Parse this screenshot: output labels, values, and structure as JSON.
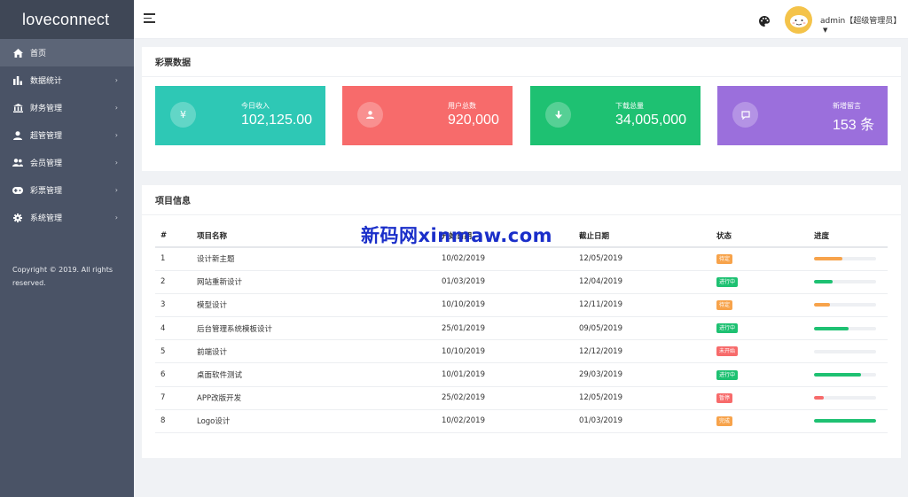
{
  "app": {
    "brand": "loveconnect"
  },
  "sidebar": {
    "items": [
      {
        "label": "首页",
        "icon": "home-icon",
        "active": true
      },
      {
        "label": "数据统计",
        "icon": "bar-chart-icon"
      },
      {
        "label": "财务管理",
        "icon": "bank-icon"
      },
      {
        "label": "超管管理",
        "icon": "person-icon"
      },
      {
        "label": "会员管理",
        "icon": "group-icon"
      },
      {
        "label": "彩票管理",
        "icon": "gamepad-icon"
      },
      {
        "label": "系统管理",
        "icon": "gear-icon"
      }
    ],
    "copyright": "Copyright © 2019. All rights reserved."
  },
  "header": {
    "user": "admin【超级管理员】"
  },
  "lottery": {
    "title": "彩票数据",
    "cards": [
      {
        "label": "今日收入",
        "value": "102,125.00",
        "color": "#2ec8b5",
        "icon": "yen-icon",
        "glyph": "¥"
      },
      {
        "label": "用户总数",
        "value": "920,000",
        "color": "#f76b6b",
        "icon": "user-icon",
        "glyph": "●"
      },
      {
        "label": "下载总量",
        "value": "34,005,000",
        "color": "#1ec172",
        "icon": "download-icon",
        "glyph": "↓"
      },
      {
        "label": "新增留言",
        "value": "153 条",
        "color": "#9b6fdc",
        "icon": "message-icon",
        "glyph": "▢"
      }
    ]
  },
  "project": {
    "title": "项目信息",
    "columns": [
      "#",
      "项目名称",
      "开始日期",
      "截止日期",
      "状态",
      "进度"
    ],
    "rows": [
      {
        "num": "1",
        "name": "设计新主题",
        "start": "10/02/2019",
        "end": "12/05/2019",
        "status": "待定",
        "status_color": "#f7a34b",
        "progress": 0.45,
        "progress_color": "#f7a34b"
      },
      {
        "num": "2",
        "name": "网站重新设计",
        "start": "01/03/2019",
        "end": "12/04/2019",
        "status": "进行中",
        "status_color": "#1ec172",
        "progress": 0.3,
        "progress_color": "#1ec172"
      },
      {
        "num": "3",
        "name": "模型设计",
        "start": "10/10/2019",
        "end": "12/11/2019",
        "status": "待定",
        "status_color": "#f7a34b",
        "progress": 0.25,
        "progress_color": "#f7a34b"
      },
      {
        "num": "4",
        "name": "后台管理系统模板设计",
        "start": "25/01/2019",
        "end": "09/05/2019",
        "status": "进行中",
        "status_color": "#1ec172",
        "progress": 0.55,
        "progress_color": "#1ec172"
      },
      {
        "num": "5",
        "name": "前端设计",
        "start": "10/10/2019",
        "end": "12/12/2019",
        "status": "未开始",
        "status_color": "#f76b6b",
        "progress": 0.0,
        "progress_color": "#f76b6b"
      },
      {
        "num": "6",
        "name": "桌面软件测试",
        "start": "10/01/2019",
        "end": "29/03/2019",
        "status": "进行中",
        "status_color": "#1ec172",
        "progress": 0.75,
        "progress_color": "#1ec172"
      },
      {
        "num": "7",
        "name": "APP改版开发",
        "start": "25/02/2019",
        "end": "12/05/2019",
        "status": "暂停",
        "status_color": "#f76b6b",
        "progress": 0.15,
        "progress_color": "#f76b6b"
      },
      {
        "num": "8",
        "name": "Logo设计",
        "start": "10/02/2019",
        "end": "01/03/2019",
        "status": "完成",
        "status_color": "#f7a34b",
        "progress": 1.0,
        "progress_color": "#1ec172"
      }
    ]
  },
  "watermark": "新码网xinmaw.com"
}
